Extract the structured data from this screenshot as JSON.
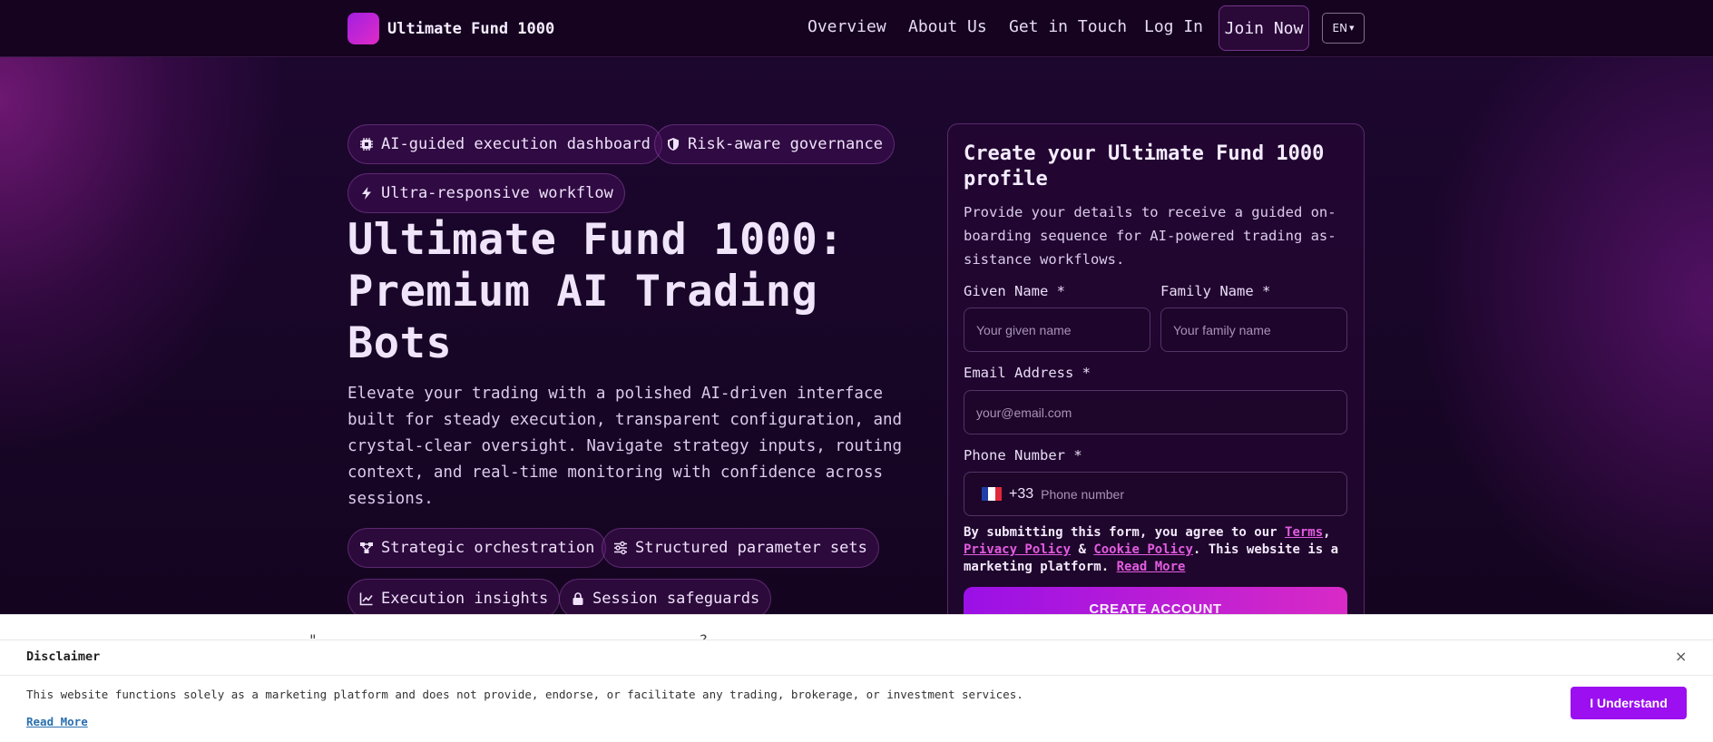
{
  "colors": {
    "accent": "#9b0ff0",
    "accent_pink": "#e35be0",
    "background": "#14051f"
  },
  "nav": {
    "brand": "Ultimate Fund 1000",
    "links": [
      "Overview",
      "About Us",
      "Get in Touch",
      "Log In"
    ],
    "join": "Join Now",
    "language": "EN"
  },
  "hero": {
    "badges": [
      {
        "icon": "chip-icon",
        "label": "AI-guided execution dashboard"
      },
      {
        "icon": "shield-icon",
        "label": "Risk-aware governance"
      },
      {
        "icon": "bolt-icon",
        "label": "Ultra-responsive workflow"
      }
    ],
    "headline": "Ultimate Fund 1000: Premium AI Trading Bots",
    "lede": "Elevate your trading with a polished AI-driven interface built for steady execution, transparent configuration, and crystal-clear oversight. Navigate strategy inputs, routing context, and real-time monitoring with confidence across sessions.",
    "features": [
      {
        "icon": "network-icon",
        "label": "Strategic orchestration"
      },
      {
        "icon": "sliders-icon",
        "label": "Structured parameter sets"
      },
      {
        "icon": "chart-line-icon",
        "label": "Execution insights"
      },
      {
        "icon": "lock-icon",
        "label": "Session safeguards"
      }
    ]
  },
  "form": {
    "title": "Create your Ultimate Fund 1000 profile",
    "subtitle": "Provide your details to receive a guided on-boarding sequence for AI-powered trading as-sistance workflows.",
    "given_label": "Given Name *",
    "given_placeholder": "Your given name",
    "family_label": "Family Name *",
    "family_placeholder": "Your family name",
    "email_label": "Email Address *",
    "email_placeholder": "your@email.com",
    "phone_label": "Phone Number *",
    "dial_code": "+33",
    "phone_placeholder": "Phone number",
    "terms_prefix": "By submitting this form, you agree to our ",
    "terms_link": "Terms",
    "comma": ",",
    "privacy_link": "Privacy Policy",
    "amp": " & ",
    "cookie_link": "Cookie Policy",
    "terms_suffix": ". This website is a marketing platform. ",
    "read_more": "Read More",
    "submit": "CREATE ACCOUNT"
  },
  "under_strip_text": "\"...   ...   ...   ...   ...   ...   ...   ...   ...   ?",
  "disclaimer": {
    "title": "Disclaimer",
    "close": "×",
    "text": "This website functions solely as a marketing platform and does not provide, endorse, or facilitate any trading, brokerage, or investment services.",
    "read_more": "Read More",
    "button": "I Understand"
  }
}
